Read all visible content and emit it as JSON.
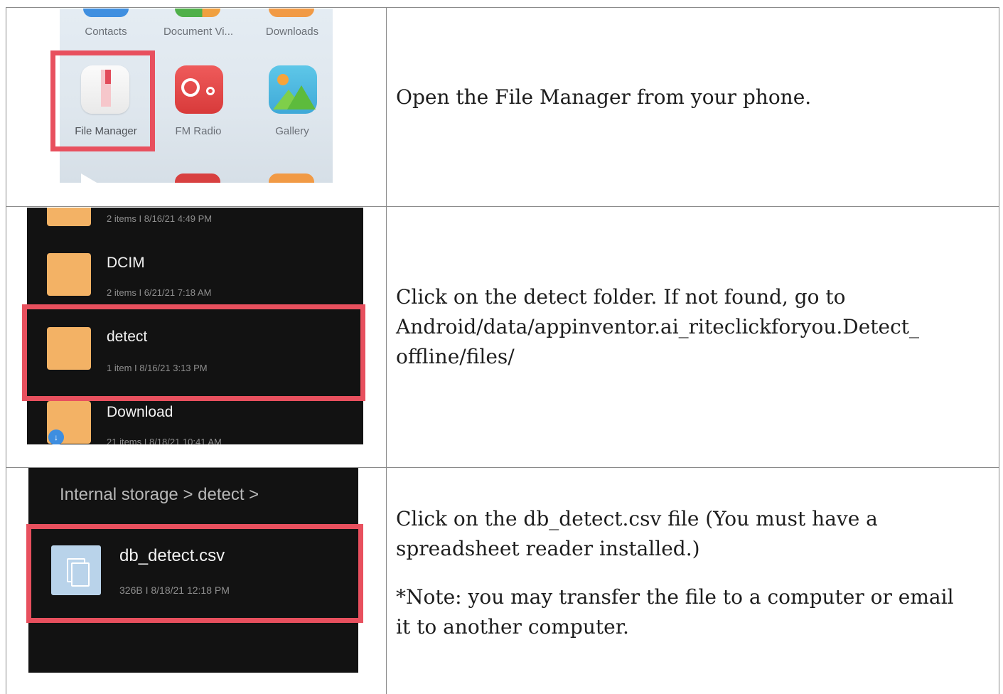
{
  "row1": {
    "launcher_labels": [
      "Contacts",
      "Document Vi...",
      "Downloads"
    ],
    "apps": [
      "File Manager",
      "FM Radio",
      "Gallery"
    ],
    "instruction": "Open the File Manager from your phone."
  },
  "row2": {
    "folders": [
      {
        "name": "",
        "meta": "2 items  I  8/16/21 4:49 PM"
      },
      {
        "name": "DCIM",
        "meta": "2 items  I  6/21/21 7:18 AM"
      },
      {
        "name": "detect",
        "meta": "1 item  I  8/16/21 3:13 PM"
      },
      {
        "name": "Download",
        "meta": "21 items  I  8/18/21 10:41 AM"
      }
    ],
    "instruction_line1": "Click on the detect folder. If not found, go to",
    "instruction_line2": "Android/data/appinventor.ai_riteclickforyou.Detect_",
    "instruction_line3": "offline/files/"
  },
  "row3": {
    "breadcrumb": "Internal storage > detect >",
    "file_name": "db_detect.csv",
    "file_meta": "326B  I  8/18/21 12:18 PM",
    "instruction_line1": "Click on the db_detect.csv file (You must have a",
    "instruction_line2": "spreadsheet reader installed.)",
    "note_line1": "*Note: you may transfer the file to a computer or email",
    "note_line2": "it to another computer."
  },
  "colors": {
    "highlight": "#e8505e",
    "folder": "#f3b265",
    "dark_bg": "#121212",
    "border": "#8a8a8a"
  }
}
